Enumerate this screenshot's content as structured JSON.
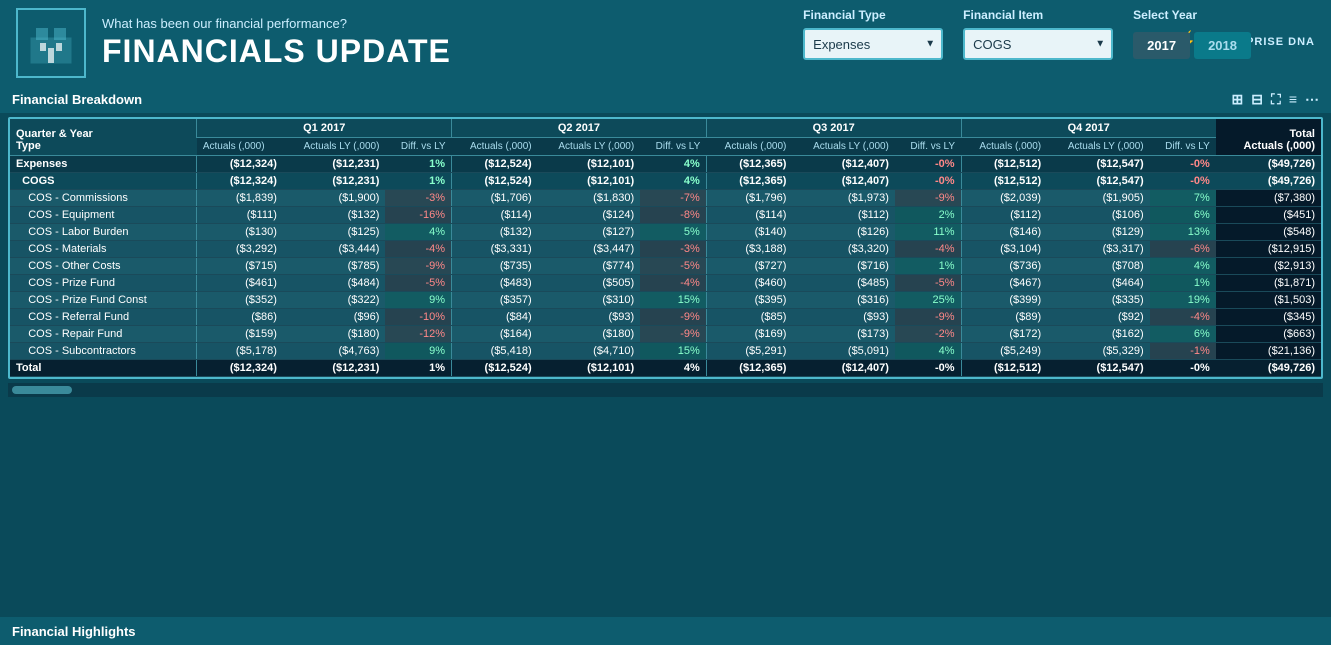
{
  "header": {
    "subtitle": "What has been our financial performance?",
    "title": "FINANCIALS UPDATE",
    "brand": "ENTERPRISE DNA"
  },
  "controls": {
    "financial_type_label": "Financial Type",
    "financial_item_label": "Financial Item",
    "select_year_label": "Select Year",
    "financial_type_value": "Expenses",
    "financial_item_value": "COGS",
    "year_2017": "2017",
    "year_2018": "2018"
  },
  "sections": {
    "financial_breakdown": "Financial Breakdown",
    "financial_highlights": "Financial Highlights"
  },
  "table": {
    "row_label_col": "Quarter & Year Type",
    "quarters": [
      {
        "label": "Q1 2017",
        "actuals": "Actuals (,000)",
        "actuals_ly": "Actuals LY (,000)",
        "diff": "Diff. vs LY"
      },
      {
        "label": "Q2 2017",
        "actuals": "Actuals (,000)",
        "actuals_ly": "Actuals LY (,000)",
        "diff": "Diff. vs LY"
      },
      {
        "label": "Q3 2017",
        "actuals": "Actuals (,000)",
        "actuals_ly": "Actuals LY (,000)",
        "diff": "Diff. vs LY"
      },
      {
        "label": "Q4 2017",
        "actuals": "Actuals (,000)",
        "actuals_ly": "Actuals LY (,000)",
        "diff": "Diff. vs LY"
      }
    ],
    "total_label": "Total Actuals (,000)",
    "rows": [
      {
        "type": "expenses",
        "label": "Expenses",
        "q1": [
          "($12,324)",
          "($12,231)",
          "1%"
        ],
        "q2": [
          "($12,524)",
          "($12,101)",
          "4%"
        ],
        "q3": [
          "($12,365)",
          "($12,407)",
          "-0%"
        ],
        "q4": [
          "($12,512)",
          "($12,547)",
          "-0%"
        ],
        "total": "($49,726)"
      },
      {
        "type": "cogs",
        "label": "COGS",
        "q1": [
          "($12,324)",
          "($12,231)",
          "1%"
        ],
        "q2": [
          "($12,524)",
          "($12,101)",
          "4%"
        ],
        "q3": [
          "($12,365)",
          "($12,407)",
          "-0%"
        ],
        "q4": [
          "($12,512)",
          "($12,547)",
          "-0%"
        ],
        "total": "($49,726)"
      },
      {
        "type": "detail",
        "label": "COS - Commissions",
        "q1": [
          "($1,839)",
          "($1,900)",
          "-3%"
        ],
        "q2": [
          "($1,706)",
          "($1,830)",
          "-7%"
        ],
        "q3": [
          "($1,796)",
          "($1,973)",
          "-9%"
        ],
        "q4": [
          "($2,039)",
          "($1,905)",
          "7%"
        ],
        "total": "($7,380)"
      },
      {
        "type": "detail",
        "label": "COS - Equipment",
        "q1": [
          "($111)",
          "($132)",
          "-16%"
        ],
        "q2": [
          "($114)",
          "($124)",
          "-8%"
        ],
        "q3": [
          "($114)",
          "($112)",
          "2%"
        ],
        "q4": [
          "($112)",
          "($106)",
          "6%"
        ],
        "total": "($451)"
      },
      {
        "type": "detail",
        "label": "COS - Labor Burden",
        "q1": [
          "($130)",
          "($125)",
          "4%"
        ],
        "q2": [
          "($132)",
          "($127)",
          "5%"
        ],
        "q3": [
          "($140)",
          "($126)",
          "11%"
        ],
        "q4": [
          "($146)",
          "($129)",
          "13%"
        ],
        "total": "($548)"
      },
      {
        "type": "detail",
        "label": "COS - Materials",
        "q1": [
          "($3,292)",
          "($3,444)",
          "-4%"
        ],
        "q2": [
          "($3,331)",
          "($3,447)",
          "-3%"
        ],
        "q3": [
          "($3,188)",
          "($3,320)",
          "-4%"
        ],
        "q4": [
          "($3,104)",
          "($3,317)",
          "-6%"
        ],
        "total": "($12,915)"
      },
      {
        "type": "detail",
        "label": "COS - Other Costs",
        "q1": [
          "($715)",
          "($785)",
          "-9%"
        ],
        "q2": [
          "($735)",
          "($774)",
          "-5%"
        ],
        "q3": [
          "($727)",
          "($716)",
          "1%"
        ],
        "q4": [
          "($736)",
          "($708)",
          "4%"
        ],
        "total": "($2,913)"
      },
      {
        "type": "detail",
        "label": "COS - Prize Fund",
        "q1": [
          "($461)",
          "($484)",
          "-5%"
        ],
        "q2": [
          "($483)",
          "($505)",
          "-4%"
        ],
        "q3": [
          "($460)",
          "($485)",
          "-5%"
        ],
        "q4": [
          "($467)",
          "($464)",
          "1%"
        ],
        "total": "($1,871)"
      },
      {
        "type": "detail",
        "label": "COS - Prize Fund Const",
        "q1": [
          "($352)",
          "($322)",
          "9%"
        ],
        "q2": [
          "($357)",
          "($310)",
          "15%"
        ],
        "q3": [
          "($395)",
          "($316)",
          "25%"
        ],
        "q4": [
          "($399)",
          "($335)",
          "19%"
        ],
        "total": "($1,503)"
      },
      {
        "type": "detail",
        "label": "COS - Referral Fund",
        "q1": [
          "($86)",
          "($96)",
          "-10%"
        ],
        "q2": [
          "($84)",
          "($93)",
          "-9%"
        ],
        "q3": [
          "($85)",
          "($93)",
          "-9%"
        ],
        "q4": [
          "($89)",
          "($92)",
          "-4%"
        ],
        "total": "($345)"
      },
      {
        "type": "detail",
        "label": "COS - Repair Fund",
        "q1": [
          "($159)",
          "($180)",
          "-12%"
        ],
        "q2": [
          "($164)",
          "($180)",
          "-9%"
        ],
        "q3": [
          "($169)",
          "($173)",
          "-2%"
        ],
        "q4": [
          "($172)",
          "($162)",
          "6%"
        ],
        "total": "($663)"
      },
      {
        "type": "detail",
        "label": "COS - Subcontractors",
        "q1": [
          "($5,178)",
          "($4,763)",
          "9%"
        ],
        "q2": [
          "($5,418)",
          "($4,710)",
          "15%"
        ],
        "q3": [
          "($5,291)",
          "($5,091)",
          "4%"
        ],
        "q4": [
          "($5,249)",
          "($5,329)",
          "-1%"
        ],
        "total": "($21,136)"
      },
      {
        "type": "total",
        "label": "Total",
        "q1": [
          "($12,324)",
          "($12,231)",
          "1%"
        ],
        "q2": [
          "($12,524)",
          "($12,101)",
          "4%"
        ],
        "q3": [
          "($12,365)",
          "($12,407)",
          "-0%"
        ],
        "q4": [
          "($12,512)",
          "($12,547)",
          "-0%"
        ],
        "total": "($49,726)"
      }
    ]
  }
}
